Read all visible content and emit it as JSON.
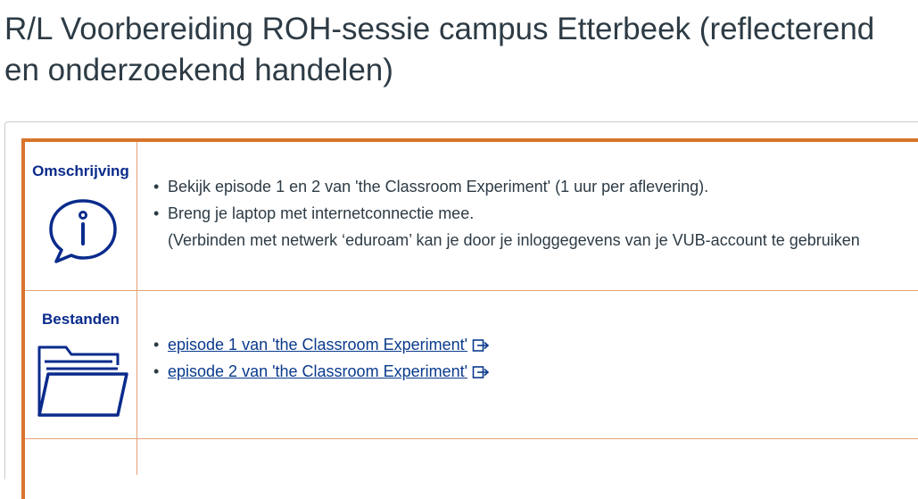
{
  "page": {
    "title": "R/L Voorbereiding ROH-sessie campus Etterbeek (reflecterend en onderzoekend handelen)"
  },
  "colors": {
    "accent_orange": "#d8742b",
    "label_blue": "#0a2b8c",
    "link_blue": "#0a3a8c"
  },
  "sections": {
    "description": {
      "label": "Omschrijving",
      "icon": "info-speech-bubble-icon",
      "items": [
        "Bekijk episode 1 en 2 van 'the Classroom Experiment' (1 uur per aflevering).",
        "Breng je laptop met internetconnectie mee."
      ],
      "note": "(Verbinden met netwerk ‘eduroam’ kan je door je inloggegevens van je VUB-account te gebruiken"
    },
    "files": {
      "label": "Bestanden",
      "icon": "folder-icon",
      "links": [
        "episode 1 van 'the Classroom Experiment'",
        "episode 2 van 'the Classroom Experiment'"
      ],
      "link_icon": "external-link-icon"
    }
  }
}
